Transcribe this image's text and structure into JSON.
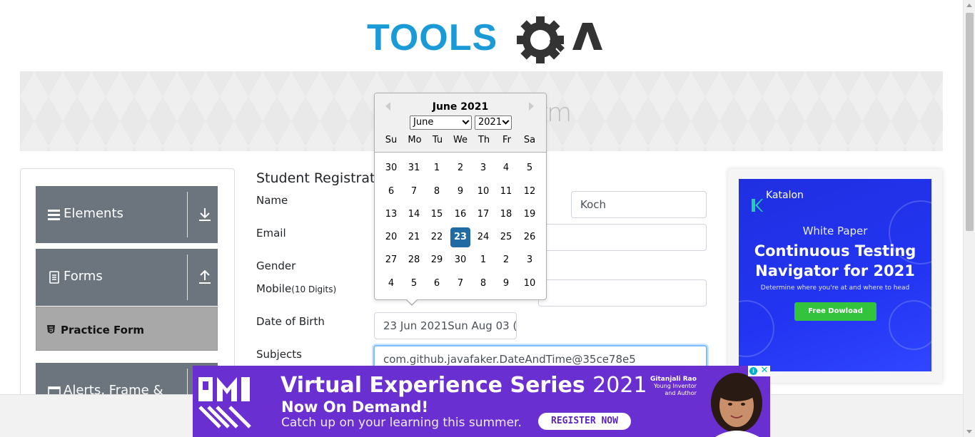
{
  "logo": {
    "text_part": "TOOLS",
    "gear_letter": "Q",
    "end_letter": "A",
    "color_blue": "#1a9bd7",
    "color_dark": "#333333"
  },
  "banner": {
    "title_fragment": "rm"
  },
  "sidebar": {
    "groups": [
      {
        "label": "Elements",
        "icon": "hamburger-icon",
        "arrow": "download-icon"
      },
      {
        "label": "Forms",
        "icon": "document-icon",
        "arrow": "upload-icon"
      },
      {
        "label": "Alerts, Frame &",
        "icon": "window-icon"
      }
    ],
    "active_item": {
      "label": "Practice Form",
      "icon": "html5-icon"
    }
  },
  "form": {
    "title": "Student Registratio",
    "labels": {
      "name": "Name",
      "email": "Email",
      "gender": "Gender",
      "mobile": "Mobile",
      "mobile_hint": "(10 Digits)",
      "dob": "Date of Birth",
      "subjects": "Subjects"
    },
    "values": {
      "last_name": "Koch",
      "dob": "23 Jun 2021Sun Aug 03 (",
      "subjects": "com.github.javafaker.DateAndTime@35ce78e5"
    }
  },
  "datepicker": {
    "header": "June 2021",
    "month_select": "June",
    "year_select": "2021",
    "weekdays": [
      "Su",
      "Mo",
      "Tu",
      "We",
      "Th",
      "Fr",
      "Sa"
    ],
    "weeks": [
      [
        "30",
        "31",
        "1",
        "2",
        "3",
        "4",
        "5"
      ],
      [
        "6",
        "7",
        "8",
        "9",
        "10",
        "11",
        "12"
      ],
      [
        "13",
        "14",
        "15",
        "16",
        "17",
        "18",
        "19"
      ],
      [
        "20",
        "21",
        "22",
        "23",
        "24",
        "25",
        "26"
      ],
      [
        "27",
        "28",
        "29",
        "30",
        "1",
        "2",
        "3"
      ],
      [
        "4",
        "5",
        "6",
        "7",
        "8",
        "9",
        "10"
      ]
    ],
    "selected_day": "23",
    "selected_color": "#216ba5"
  },
  "right_ad": {
    "brand": "Katalon",
    "kicker": "White Paper",
    "headline_line1": "Continuous Testing",
    "headline_line2": "Navigator for 2021",
    "subline": "Determine where you're at and where to head",
    "cta": "Free Dowload",
    "bg_color": "#2335f2",
    "cta_color": "#34c33c"
  },
  "bottom_ad": {
    "headline": "Virtual Experience Series",
    "year": "2021",
    "line2": "Now On Demand!",
    "line3": "Catch up on your learning this summer.",
    "cta": "REGISTER NOW",
    "speaker_name": "Gitanjali Rao",
    "speaker_role1": "Young Inventor",
    "speaker_role2": "and Author",
    "bg_color": "#6a2fd0"
  },
  "ad_choices": {
    "info": "i",
    "close": "✕"
  }
}
